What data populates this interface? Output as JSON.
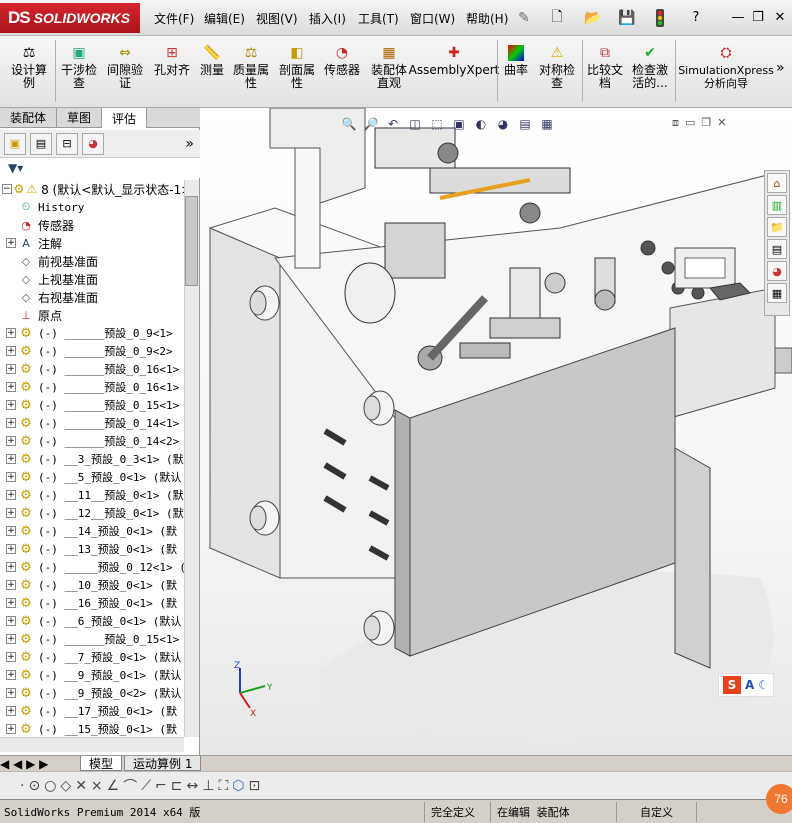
{
  "app": {
    "logo_text": "SOLIDWORKS",
    "logo_mark": "DS"
  },
  "menu": [
    "文件(F)",
    "编辑(E)",
    "视图(V)",
    "插入(I)",
    "工具(T)",
    "窗口(W)",
    "帮助(H)"
  ],
  "window_controls": {
    "help": "?",
    "minimize": "—",
    "restore": "❐",
    "close": "✕"
  },
  "commands": [
    {
      "label": "设计算例",
      "icon": "design-study-icon"
    },
    {
      "label": "干涉检查",
      "icon": "interference-icon"
    },
    {
      "label": "间隙验证",
      "icon": "clearance-icon"
    },
    {
      "label": "孔对齐",
      "icon": "hole-align-icon"
    },
    {
      "label": "测量",
      "icon": "measure-icon"
    },
    {
      "label": "质量属性",
      "icon": "mass-props-icon"
    },
    {
      "label": "剖面属性",
      "icon": "section-props-icon"
    },
    {
      "label": "传感器",
      "icon": "sensor-icon"
    },
    {
      "label": "装配体直观",
      "icon": "assembly-visual-icon"
    },
    {
      "label": "AssemblyXpert",
      "icon": "assemblyxpert-icon"
    },
    {
      "label": "曲率",
      "icon": "curvature-icon"
    },
    {
      "label": "对称检查",
      "icon": "symmetry-icon"
    },
    {
      "label": "比较文档",
      "icon": "compare-icon"
    },
    {
      "label": "检查激活的...",
      "icon": "check-active-icon"
    },
    {
      "label": "SimulationXpress 分析向导",
      "icon": "simulation-icon"
    }
  ],
  "more": "»",
  "tabs": [
    "装配体",
    "草图",
    "评估"
  ],
  "tree": {
    "root": "8  (默认<默认_显示状态-1>)",
    "items": [
      {
        "label": "History",
        "type": "history"
      },
      {
        "label": "传感器",
        "type": "sensor"
      },
      {
        "label": "注解",
        "type": "annotation",
        "exp": true
      },
      {
        "label": "前视基准面",
        "type": "plane"
      },
      {
        "label": "上视基准面",
        "type": "plane"
      },
      {
        "label": "右视基准面",
        "type": "plane"
      },
      {
        "label": "原点",
        "type": "origin"
      },
      {
        "label": "(-) ______预設_0_9<1>",
        "type": "part",
        "exp": true
      },
      {
        "label": "(-) ______预設_0_9<2>",
        "type": "part",
        "exp": true
      },
      {
        "label": "(-) ______预設_0_16<1> (",
        "type": "part",
        "exp": true
      },
      {
        "label": "(-) ______预設_0_16<1>",
        "type": "part",
        "exp": true
      },
      {
        "label": "(-) ______预設_0_15<1>",
        "type": "part",
        "exp": true
      },
      {
        "label": "(-) ______预設_0_14<1>",
        "type": "part",
        "exp": true
      },
      {
        "label": "(-) ______预設_0_14<2>",
        "type": "part",
        "exp": true
      },
      {
        "label": "(-) __3_预設_0_3<1> (默",
        "type": "part",
        "exp": true
      },
      {
        "label": "(-) __5_预設_0<1> (默认",
        "type": "part",
        "exp": true
      },
      {
        "label": "(-) __11__预設_0<1> (默",
        "type": "part",
        "exp": true
      },
      {
        "label": "(-) __12__预設_0<1> (默",
        "type": "part",
        "exp": true
      },
      {
        "label": "(-) __14_预設_0<1> (默",
        "type": "part",
        "exp": true
      },
      {
        "label": "(-) __13_预設_0<1> (默",
        "type": "part",
        "exp": true
      },
      {
        "label": "(-) _____预設_0_12<1> (默",
        "type": "part",
        "exp": true
      },
      {
        "label": "(-) __10_预設_0<1> (默",
        "type": "part",
        "exp": true
      },
      {
        "label": "(-) __16_预設_0<1> (默",
        "type": "part",
        "exp": true
      },
      {
        "label": "(-) __6_预設_0<1> (默认",
        "type": "part",
        "exp": true
      },
      {
        "label": "(-) ______预設_0_15<1> (",
        "type": "part",
        "exp": true
      },
      {
        "label": "(-) __7_预設_0<1> (默认",
        "type": "part",
        "exp": true
      },
      {
        "label": "(-) __9_预設_0<1> (默认",
        "type": "part",
        "exp": true
      },
      {
        "label": "(-) __9_预設_0<2> (默认",
        "type": "part",
        "exp": true
      },
      {
        "label": "(-) __17_预設_0<1> (默",
        "type": "part",
        "exp": true
      },
      {
        "label": "(-) __15_预設_0<1> (默",
        "type": "part",
        "exp": true
      }
    ]
  },
  "bottom_tabs": [
    "模型",
    "运动算例 1"
  ],
  "status": {
    "app_version": "SolidWorks Premium 2014 x64 版",
    "state": "完全定义",
    "mode": "在编辑 装配体",
    "custom": "自定义",
    "badge": "76"
  },
  "triad": {
    "x": "X",
    "y": "Y",
    "z": "Z"
  },
  "ime": {
    "s": "S",
    "a": "A"
  }
}
